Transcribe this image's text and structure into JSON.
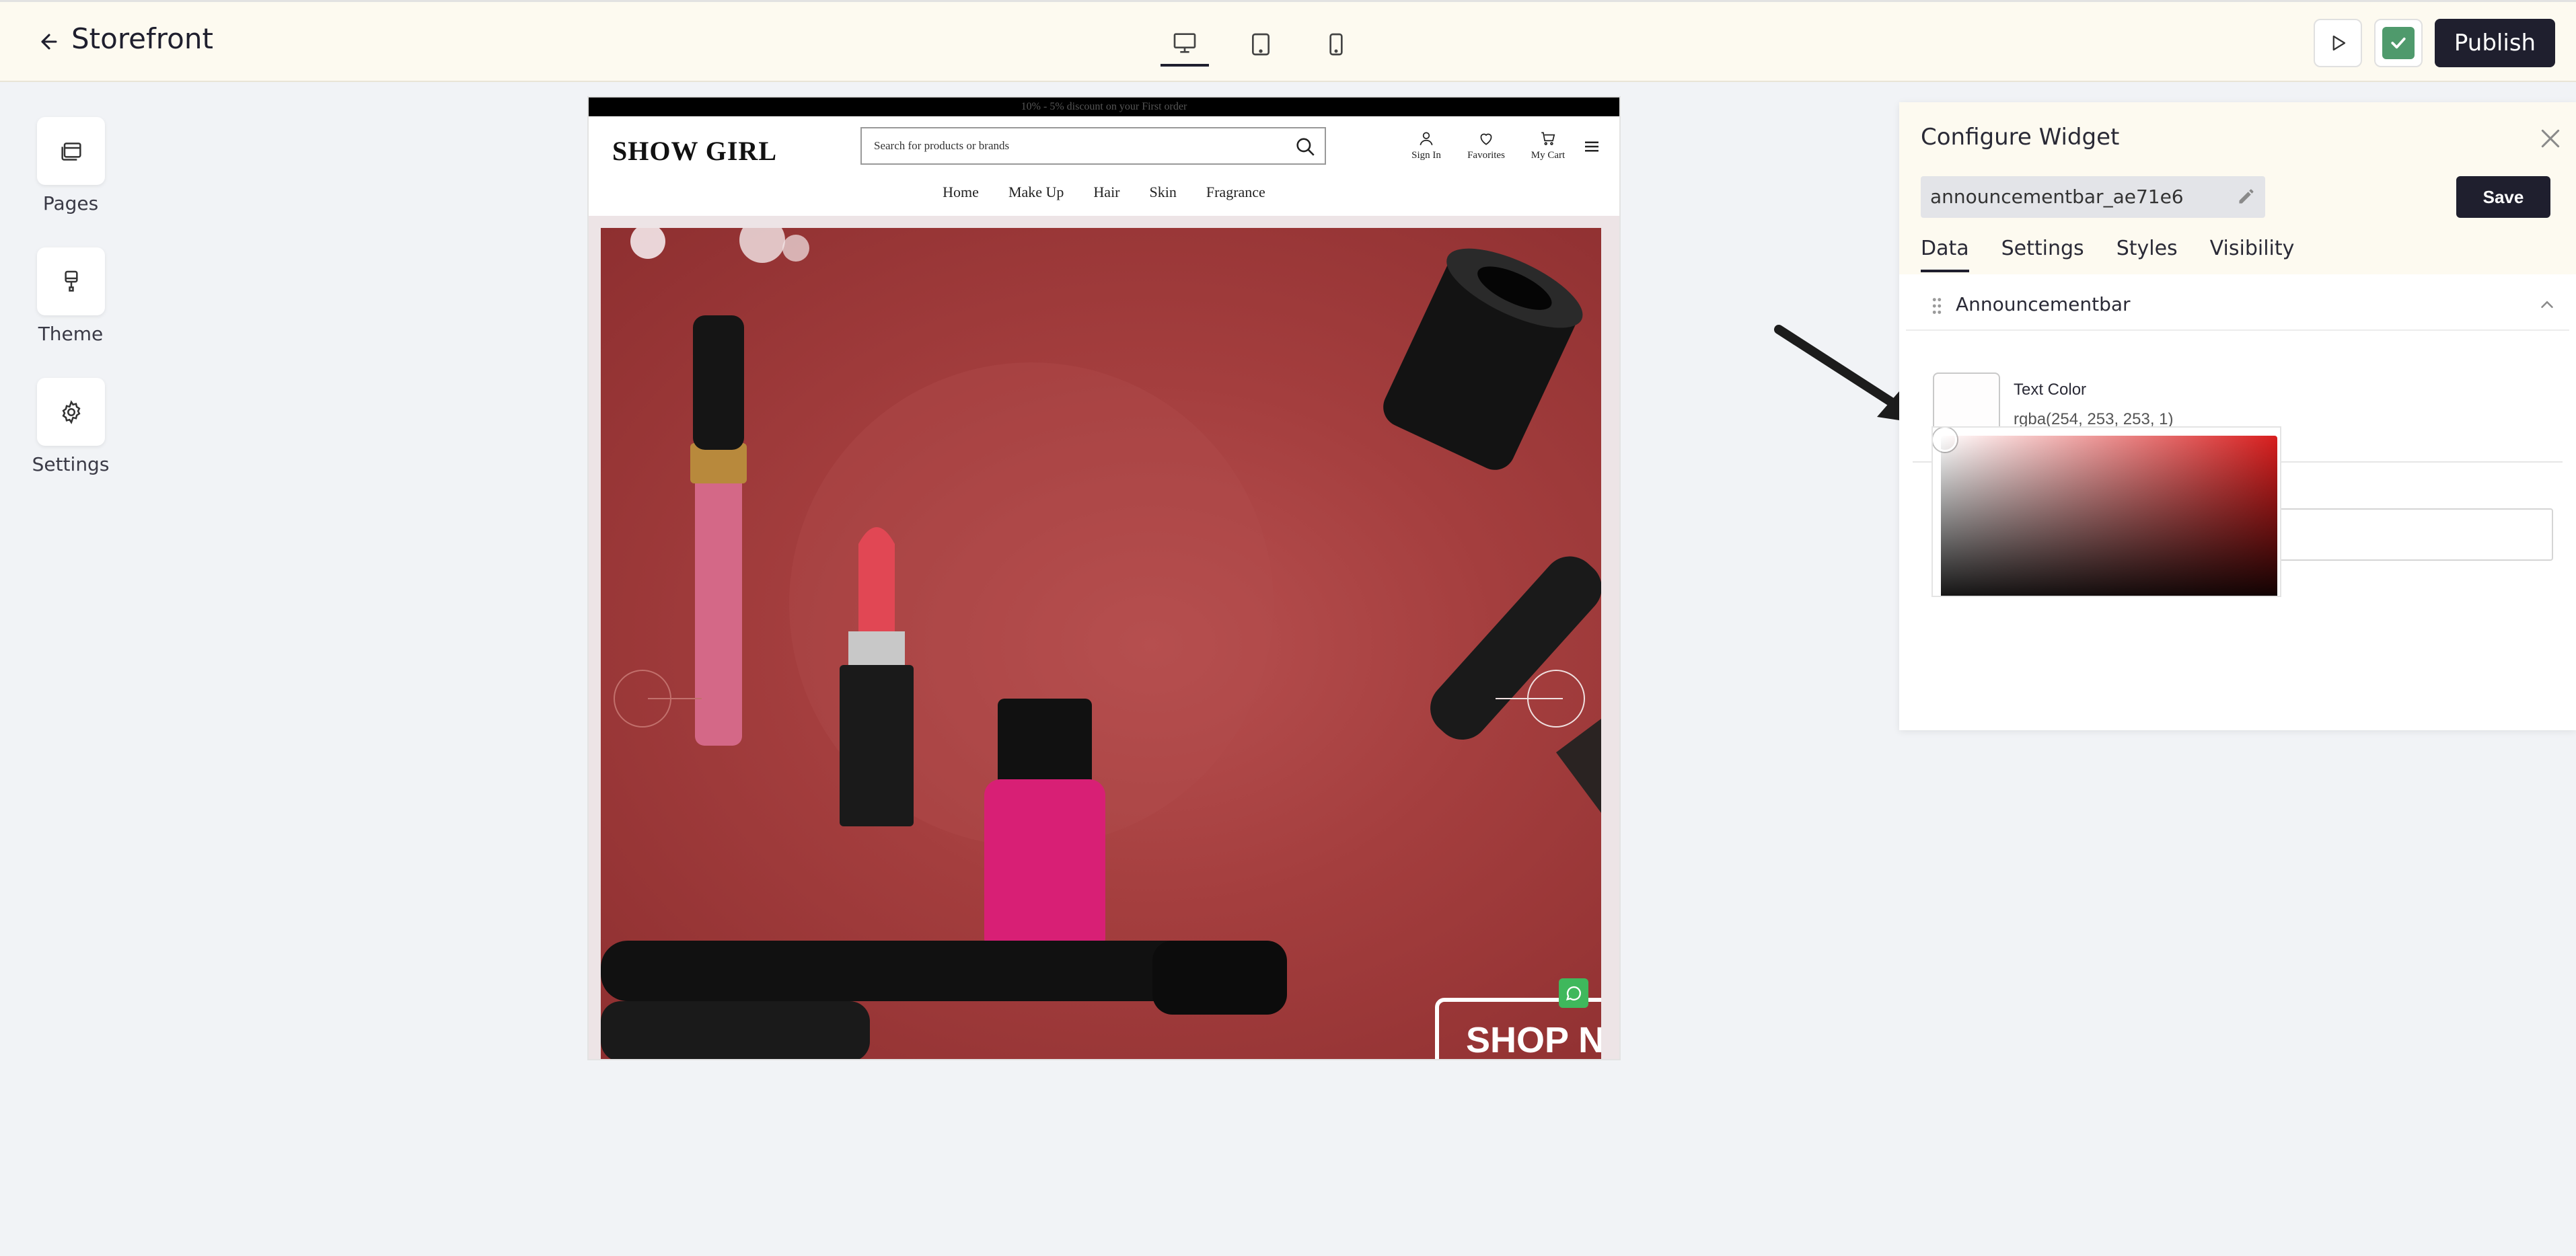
{
  "app": {
    "title": "Storefront"
  },
  "toolbar": {
    "publish_label": "Publish"
  },
  "devices": [
    "desktop",
    "tablet",
    "mobile"
  ],
  "rail": {
    "pages_label": "Pages",
    "theme_label": "Theme",
    "settings_label": "Settings"
  },
  "preview": {
    "announcement": "10% - 5% discount on your First order",
    "logo": "SHOW GIRL",
    "search_placeholder": "Search for products or brands",
    "header_icons": {
      "sign_in": "Sign In",
      "favorites": "Favorites",
      "cart": "My Cart"
    },
    "nav": [
      "Home",
      "Make Up",
      "Hair",
      "Skin",
      "Fragrance"
    ],
    "hero_cta": "SHOP N"
  },
  "panel": {
    "title": "Configure Widget",
    "widget_id": "announcementbar_ae71e6",
    "save_label": "Save",
    "tabs": [
      "Data",
      "Settings",
      "Styles",
      "Visibility"
    ],
    "active_tab": "Data",
    "section_label": "Announcementbar",
    "text_color_label": "Text Color",
    "text_color_value": "rgba(254, 253, 253, 1)"
  },
  "colors": {
    "accent_dark": "#1f1f2e",
    "header_bg": "#fdfaf0",
    "check_green": "#4f9a6c",
    "hero_red": "#a43e3e",
    "picker_hue": "#d81e1e"
  }
}
